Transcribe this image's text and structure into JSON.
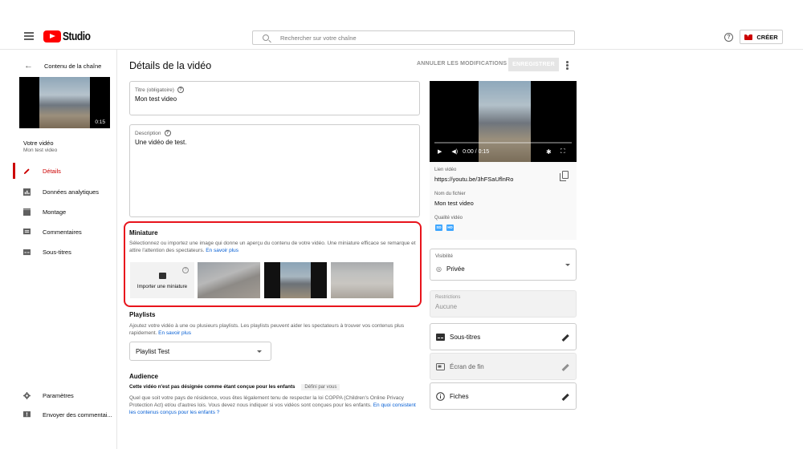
{
  "header": {
    "logo_text": "Studio",
    "search_placeholder": "Rechercher sur votre chaîne",
    "create_label": "CRÉER"
  },
  "sidebar": {
    "back_label": "Contenu de la chaîne",
    "video_duration": "0:15",
    "video_title": "Votre vidéo",
    "video_subtitle": "Mon test video",
    "items": [
      {
        "label": "Détails",
        "icon": "pencil-icon",
        "active": true
      },
      {
        "label": "Données analytiques",
        "icon": "analytics-icon"
      },
      {
        "label": "Montage",
        "icon": "clapper-icon"
      },
      {
        "label": "Commentaires",
        "icon": "comment-icon"
      },
      {
        "label": "Sous-titres",
        "icon": "subtitles-icon"
      }
    ],
    "bottom": [
      {
        "label": "Paramètres",
        "icon": "gear-icon"
      },
      {
        "label": "Envoyer des commentai...",
        "icon": "feedback-icon"
      }
    ]
  },
  "main": {
    "page_title": "Détails de la vidéo",
    "undo_label": "ANNULER LES MODIFICATIONS",
    "save_label": "ENREGISTRER",
    "title_field": {
      "label": "Titre (obligatoire)",
      "value": "Mon test video"
    },
    "description_field": {
      "label": "Description",
      "value": "Une vidéo de test."
    },
    "thumbnail": {
      "heading": "Miniature",
      "text": "Sélectionnez ou importez une image qui donne un aperçu du contenu de votre vidéo. Une miniature efficace se remarque et attire l'attention des spectateurs.",
      "link": "En savoir plus",
      "upload_label": "Importer une miniature"
    },
    "playlists": {
      "heading": "Playlists",
      "text": "Ajoutez votre vidéo à une ou plusieurs playlists. Les playlists peuvent aider les spectateurs à trouver vos contenus plus rapidement.",
      "link": "En savoir plus",
      "selected": "Playlist Test"
    },
    "audience": {
      "heading": "Audience",
      "status": "Cette vidéo n'est pas désignée comme étant conçue pour les enfants",
      "badge": "Défini par vous",
      "text": "Quel que soit votre pays de résidence, vous êtes légalement tenu de respecter la loi COPPA (Children's Online Privacy Protection Act) et/ou d'autres lois. Vous devez nous indiquer si vos vidéos sont conçues pour les enfants.",
      "link": "En quoi consistent les contenus conçus pour les enfants ?"
    }
  },
  "right": {
    "time": "0:00 / 0:15",
    "link_label": "Lien vidéo",
    "link_value": "https://youtu.be/3hFSaUflnRo",
    "file_label": "Nom du fichier",
    "file_value": "Mon test video",
    "quality_label": "Qualité vidéo",
    "quality_badges": [
      "SD",
      "HD"
    ],
    "visibility_label": "Visibilité",
    "visibility_value": "Privée",
    "restrictions_label": "Restrictions",
    "restrictions_value": "Aucune",
    "subtitles_label": "Sous-titres",
    "endscreen_label": "Écran de fin",
    "cards_label": "Fiches"
  },
  "colors": {
    "accent": "#cc0000",
    "link": "#065fd4",
    "highlight_box": "#e8141c"
  }
}
